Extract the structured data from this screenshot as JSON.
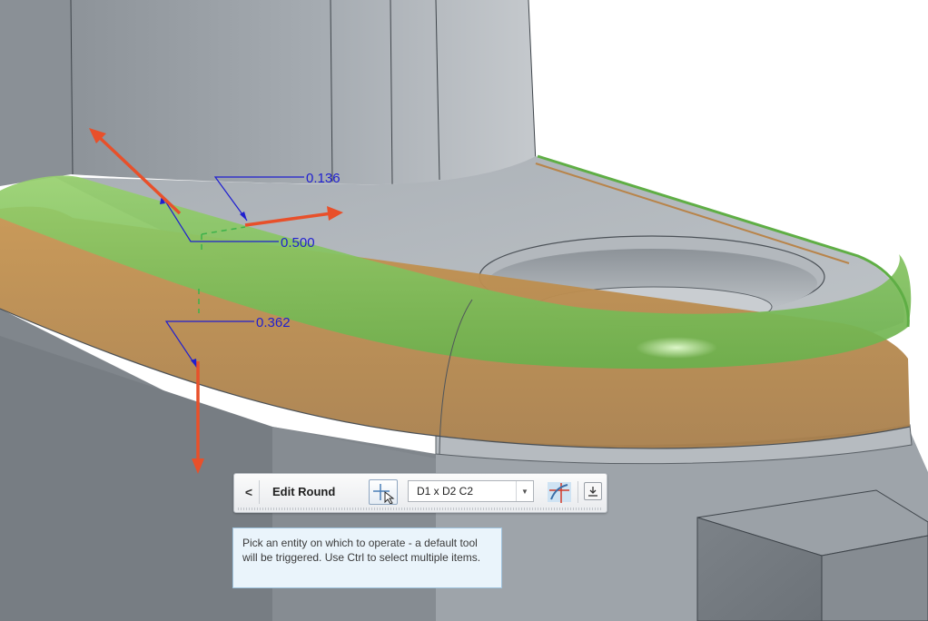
{
  "dimensions": {
    "d1": "0.136",
    "d2": "0.500",
    "d3": "0.362"
  },
  "toolbar": {
    "back_label": "<",
    "title": "Edit Round",
    "dropdown_value": "D1 x D2 C2"
  },
  "tooltip": {
    "text": "Pick an entity on which to operate - a default tool will be triggered. Use Ctrl to select multiple items."
  },
  "colors": {
    "model_gray": "#9ba1a7",
    "round_green": "#7fc25c",
    "round_orange": "#c99654",
    "dimension_blue": "#1f1fd0",
    "drag_arrow": "#e8502a"
  }
}
